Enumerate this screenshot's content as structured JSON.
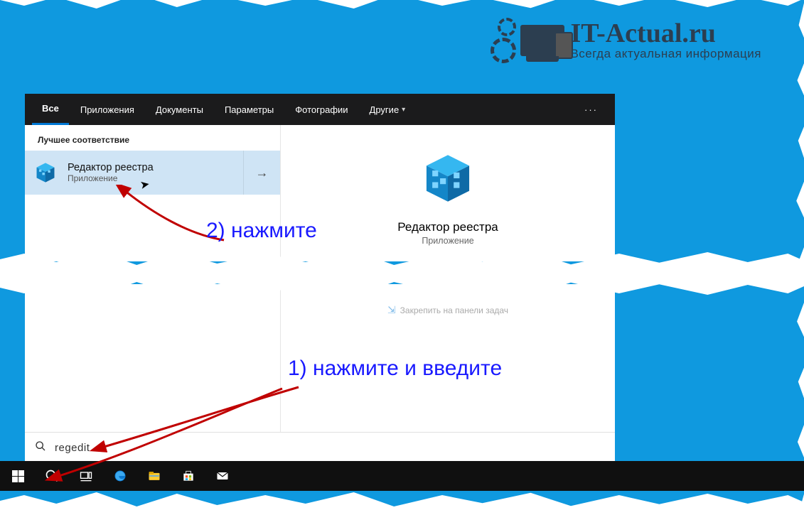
{
  "brand": {
    "title": "IT-Actual.ru",
    "sub": "Всегда актуальная информация"
  },
  "tabs": {
    "all": "Все",
    "apps": "Приложения",
    "docs": "Документы",
    "params": "Параметры",
    "photos": "Фотографии",
    "other": "Другие"
  },
  "left": {
    "section": "Лучшее соответствие",
    "title": "Редактор реестра",
    "sub": "Приложение"
  },
  "detail": {
    "title": "Редактор реестра",
    "sub": "Приложение",
    "action": "Закрепить на панели задач"
  },
  "search": {
    "placeholder": "",
    "value": "regedit"
  },
  "annot": {
    "press_enter": "1) нажмите и введите",
    "click": "2) нажмите"
  }
}
